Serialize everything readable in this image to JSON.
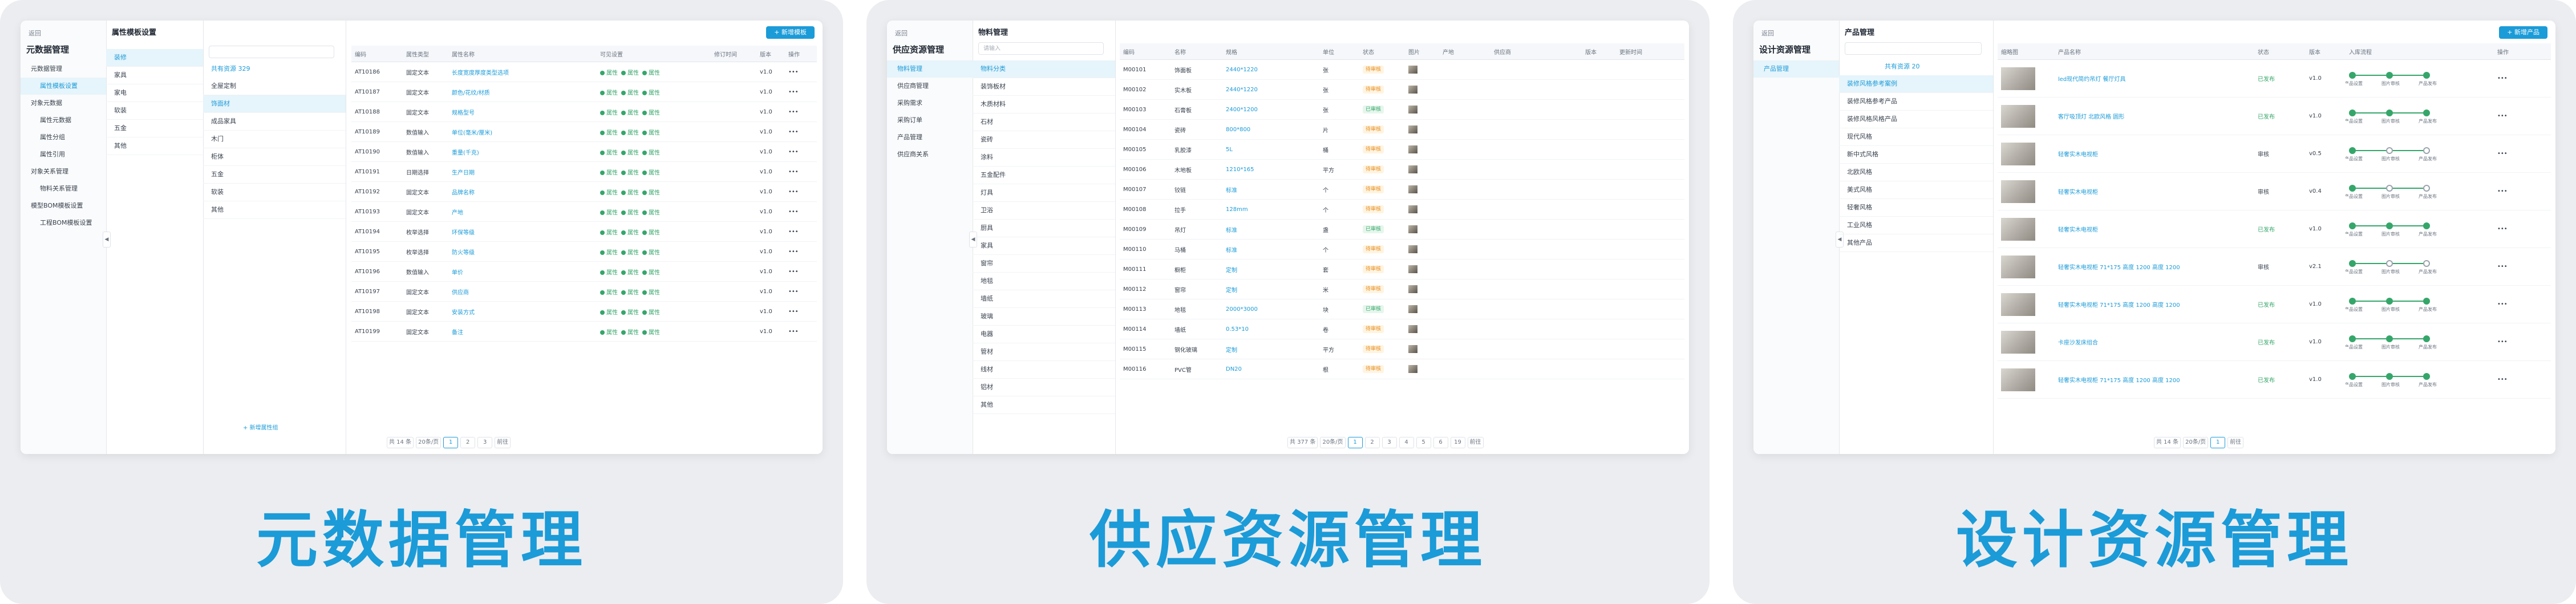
{
  "captions": [
    "元数据管理",
    "供应资源管理",
    "设计资源管理"
  ],
  "meta": {
    "back": "返回",
    "app_title": "元数据管理",
    "nav": [
      "元数据管理",
      "属性模板设置",
      "对象元数据",
      "属性元数据",
      "属性分组",
      "属性引用",
      "对象关系管理",
      "物料关系管理",
      "模型BOM模板设置",
      "工程BOM模板设置"
    ],
    "page_title": "属性模板设置",
    "add_btn": "+ 新增模板",
    "categories": [
      "装修",
      "家具",
      "家电",
      "软装",
      "五金",
      "其他"
    ],
    "tree_header": "共有资源 329",
    "tree": [
      "全屋定制",
      "饰面材",
      "成品家具",
      "木门",
      "柜体",
      "五金",
      "软装",
      "其他"
    ],
    "add_group": "+ 新增属性组",
    "columns": [
      "编码",
      "属性类型",
      "属性名称",
      "可见设置",
      "修订时间",
      "版本",
      "操作"
    ],
    "rows": [
      [
        "AT10186",
        "固定文本",
        "长度宽度厚度类型选项"
      ],
      [
        "AT10187",
        "固定文本",
        "颜色/花纹/材质"
      ],
      [
        "AT10188",
        "固定文本",
        "规格型号"
      ],
      [
        "AT10189",
        "数值输入",
        "单位(毫米/厘米)"
      ],
      [
        "AT10190",
        "数值输入",
        "重量(千克)"
      ],
      [
        "AT10191",
        "日期选择",
        "生产日期"
      ],
      [
        "AT10192",
        "固定文本",
        "品牌名称"
      ],
      [
        "AT10193",
        "固定文本",
        "产地"
      ],
      [
        "AT10194",
        "枚举选择",
        "环保等级"
      ],
      [
        "AT10195",
        "枚举选择",
        "防火等级"
      ],
      [
        "AT10196",
        "数值输入",
        "单价"
      ],
      [
        "AT10197",
        "固定文本",
        "供应商"
      ],
      [
        "AT10198",
        "固定文本",
        "安装方式"
      ],
      [
        "AT10199",
        "固定文本",
        "备注"
      ]
    ],
    "vis": "属性",
    "ver": "v1.0",
    "pager": {
      "total": "共 14 条",
      "size": "20条/页",
      "pages": [
        "1",
        "2",
        "3"
      ],
      "goto": "前往"
    }
  },
  "supply": {
    "back": "返回",
    "app_title": "供应资源管理",
    "nav": [
      "物料管理",
      "供应商管理",
      "采购需求",
      "采购订单",
      "产品管理",
      "供应商关系"
    ],
    "page_title": "物料管理",
    "search_ph": "请输入",
    "tree": [
      "物料分类",
      "装饰板材",
      "木质材料",
      "石材",
      "瓷砖",
      "涂料",
      "五金配件",
      "灯具",
      "卫浴",
      "厨具",
      "家具",
      "窗帘",
      "地毯",
      "墙纸",
      "玻璃",
      "电器",
      "管材",
      "线材",
      "铝材",
      "其他"
    ],
    "columns": [
      "编码",
      "名称",
      "规格",
      "单位",
      "状态",
      "图片",
      "产地",
      "供应商",
      "版本",
      "更新时间"
    ],
    "rows": [
      [
        "M00101",
        "饰面板",
        "2440*1220",
        "张",
        "待审核"
      ],
      [
        "M00102",
        "实木板",
        "2440*1220",
        "张",
        "待审核"
      ],
      [
        "M00103",
        "石膏板",
        "2400*1200",
        "张",
        "已审核"
      ],
      [
        "M00104",
        "瓷砖",
        "800*800",
        "片",
        "待审核"
      ],
      [
        "M00105",
        "乳胶漆",
        "5L",
        "桶",
        "待审核"
      ],
      [
        "M00106",
        "木地板",
        "1210*165",
        "平方",
        "待审核"
      ],
      [
        "M00107",
        "铰链",
        "标准",
        "个",
        "待审核"
      ],
      [
        "M00108",
        "拉手",
        "128mm",
        "个",
        "待审核"
      ],
      [
        "M00109",
        "吊灯",
        "标准",
        "盏",
        "已审核"
      ],
      [
        "M00110",
        "马桶",
        "标准",
        "个",
        "待审核"
      ],
      [
        "M00111",
        "橱柜",
        "定制",
        "套",
        "待审核"
      ],
      [
        "M00112",
        "窗帘",
        "定制",
        "米",
        "待审核"
      ],
      [
        "M00113",
        "地毯",
        "2000*3000",
        "块",
        "已审核"
      ],
      [
        "M00114",
        "墙纸",
        "0.53*10",
        "卷",
        "待审核"
      ],
      [
        "M00115",
        "钢化玻璃",
        "定制",
        "平方",
        "待审核"
      ],
      [
        "M00116",
        "PVC管",
        "DN20",
        "根",
        "待审核"
      ]
    ],
    "pager": {
      "total": "共 377 条",
      "size": "20条/页",
      "pages": [
        "1",
        "2",
        "3",
        "4",
        "5",
        "6",
        "19"
      ],
      "goto": "前往"
    }
  },
  "design": {
    "back": "返回",
    "app_title": "设计资源管理",
    "nav": [
      "产品管理"
    ],
    "page_title": "产品管理",
    "add_btn": "+ 新增产品",
    "tree_header": "共有资源 20",
    "tree": [
      "装修风格参考案例",
      "装修风格参考产品",
      "装修风格风格产品",
      "现代风格",
      "新中式风格",
      "北欧风格",
      "美式风格",
      "轻奢风格",
      "工业风格",
      "其他产品"
    ],
    "columns": [
      "缩略图",
      "产品名称",
      "状态",
      "版本",
      "入库流程",
      "操作"
    ],
    "rows": [
      [
        "led现代简约吊灯 餐厅灯具",
        "已发布",
        "v1.0"
      ],
      [
        "客厅吸顶灯 北欧风格 圆形",
        "已发布",
        "v1.0"
      ],
      [
        "轻奢实木电视柜",
        "审核",
        "v0.5"
      ],
      [
        "轻奢实木电视柜",
        "审核",
        "v0.4"
      ],
      [
        "轻奢实木电视柜",
        "已发布",
        "v1.0"
      ],
      [
        "轻奢实木电视柜 71*175 高度 1200 高度 1200",
        "审核",
        "v2.1"
      ],
      [
        "轻奢实木电视柜 71*175 高度 1200 高度 1200",
        "已发布",
        "v1.0"
      ],
      [
        "卡座沙发床组合",
        "已发布",
        "v1.0"
      ],
      [
        "轻奢实木电视柜 71*175 高度 1200 高度 1200",
        "已发布",
        "v1.0"
      ]
    ],
    "steps": [
      "产品设置",
      "图片审核",
      "产品发布"
    ],
    "pager": {
      "total": "共 14 条",
      "size": "20条/页",
      "pages": [
        "1"
      ],
      "goto": "前往"
    }
  }
}
